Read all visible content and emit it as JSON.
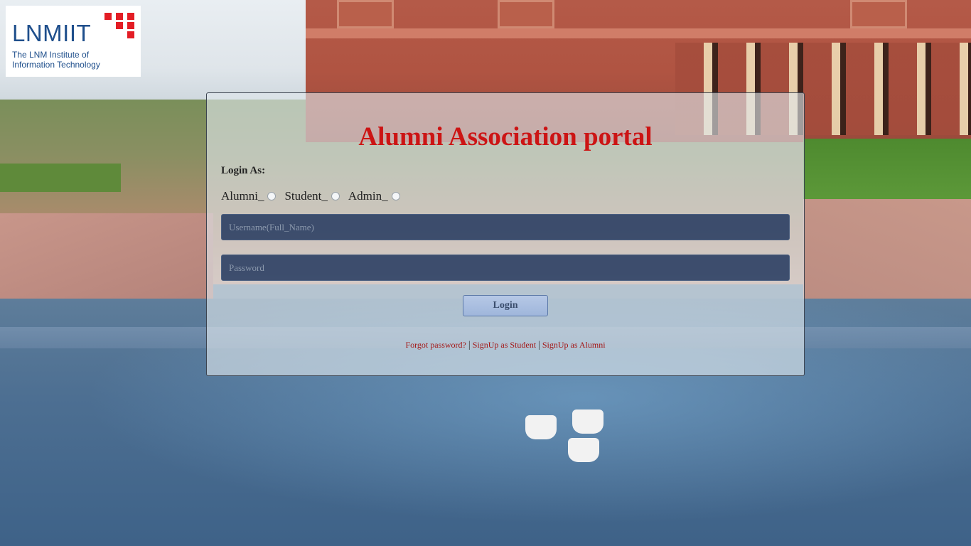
{
  "logo": {
    "wordmark": "LNMIIT",
    "subtitle": "The LNM Institute of Information Technology"
  },
  "login": {
    "title": "Alumni Association portal",
    "login_as_label": "Login As:",
    "roles": [
      {
        "label": "Alumni_",
        "selected": false
      },
      {
        "label": "Student_",
        "selected": false
      },
      {
        "label": "Admin_",
        "selected": false
      }
    ],
    "username_placeholder": "Username(Full_Name)",
    "password_placeholder": "Password",
    "login_button": "Login",
    "links": {
      "forgot": "Forgot password?",
      "signup_student": "SignUp as Student",
      "signup_alumni": "SignUp as Alumni",
      "separator": "|"
    }
  },
  "colors": {
    "title": "#cc1414",
    "link": "#a31515",
    "field_bg": "#1c325a",
    "logo_blue": "#1f4f8c",
    "logo_red": "#e31d25"
  }
}
